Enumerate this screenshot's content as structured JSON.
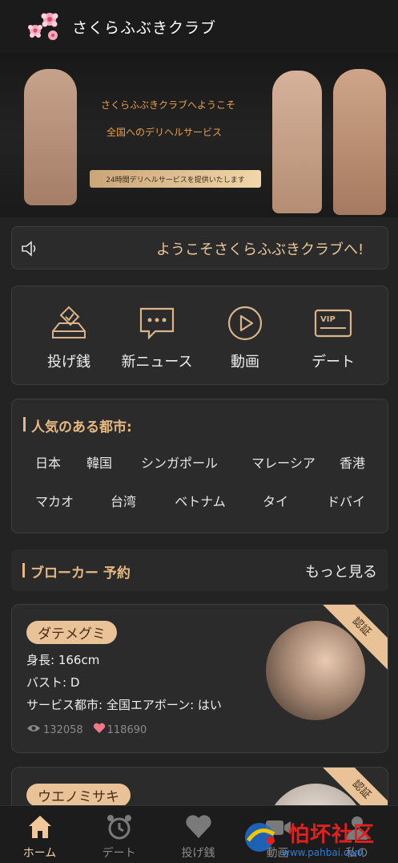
{
  "header": {
    "title": "さくらふぶきクラブ"
  },
  "banner": {
    "line1": "さくらふぶきクラブへようこそ",
    "line2": "全国へのデリヘルサービス",
    "pill": "24時間デリヘルサービスを提供いたします"
  },
  "notice": {
    "text": "ようこそさくらふぶきクラブへ!"
  },
  "quick_menu": [
    {
      "label": "投げ銭",
      "icon": "ballot-box-icon"
    },
    {
      "label": "新ニュース",
      "icon": "message-icon"
    },
    {
      "label": "動画",
      "icon": "play-icon"
    },
    {
      "label": "デート",
      "icon": "vip-card-icon"
    }
  ],
  "cities": {
    "title": "人気のある都市:",
    "row1": [
      "日本",
      "韓国",
      "シンガポール",
      "マレーシア",
      "香港"
    ],
    "row2": [
      "マカオ",
      "台湾",
      "ベトナム",
      "タイ",
      "ドバイ"
    ]
  },
  "brokers": {
    "title": "ブローカー 予約",
    "more": "もっと見る",
    "cards": [
      {
        "name": "ダテメグミ",
        "height": "身長: 166cm",
        "bust": "バスト: D",
        "city": "サービス都市: 全国エアボーン: はい",
        "views": "132058",
        "likes": "118690",
        "badge": "認証"
      },
      {
        "name": "ウエノミサキ",
        "badge": "認証"
      }
    ]
  },
  "tabbar": [
    {
      "label": "ホーム",
      "active": true
    },
    {
      "label": "デート",
      "active": false
    },
    {
      "label": "投げ銭",
      "active": false
    },
    {
      "label": "動画",
      "active": false
    },
    {
      "label": "私の",
      "active": false
    }
  ],
  "watermark": {
    "text": "怕坏社区",
    "url": "www.pahbai.com"
  },
  "colors": {
    "accent": "#e9c397",
    "gold_text": "#e6b882",
    "background": "#232323"
  }
}
